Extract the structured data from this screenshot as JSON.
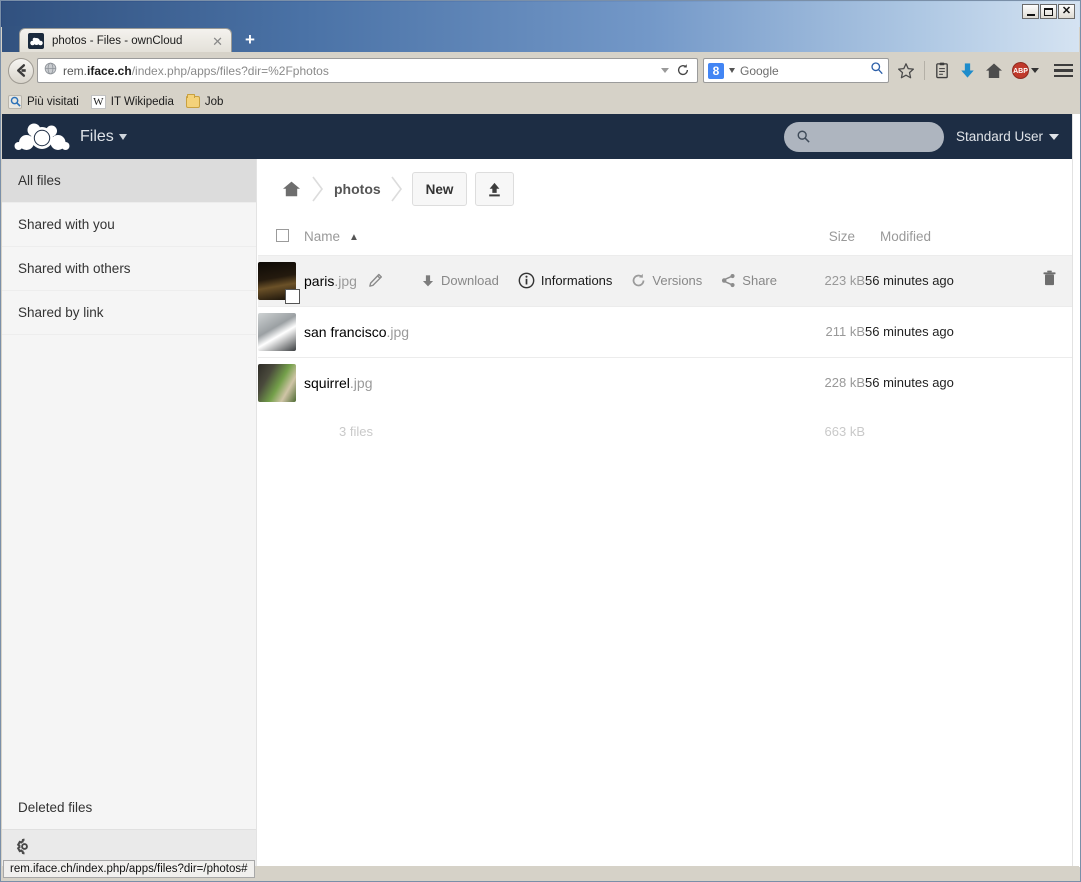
{
  "browser": {
    "window_controls": {
      "minimize": "_",
      "maximize": "□",
      "close": "✕"
    },
    "tab": {
      "title": "photos - Files - ownCloud",
      "favicon": "owncloud-icon",
      "close": "✕"
    },
    "new_tab_label": "+",
    "back_button": "back-arrow-icon",
    "url": {
      "prefix": "rem.",
      "host_bold": "iface.ch",
      "path": "/index.php/apps/files?dir=%2Fphotos"
    },
    "search": {
      "engine": "Google",
      "engine_icon": "google-g-icon"
    },
    "toolbar_icons": [
      "bookmark-star-icon",
      "reader-list-icon",
      "download-arrow-icon",
      "home-icon",
      "adblock-plus-icon",
      "menu-hamburger-icon"
    ],
    "adblock_label": "ABP",
    "bookmarks": [
      {
        "label": "Più visitati",
        "icon": "most-visited-icon"
      },
      {
        "label": "IT Wikipedia",
        "icon": "wikipedia-w-icon"
      },
      {
        "label": "Job",
        "icon": "folder-icon"
      }
    ],
    "status_tooltip": "rem.iface.ch/index.php/apps/files?dir=/photos#"
  },
  "owncloud": {
    "header": {
      "logo": "owncloud-cloud-logo",
      "app_name": "Files",
      "app_caret": "▾",
      "search_icon": "search-icon",
      "search_placeholder": "",
      "user_name": "Standard User",
      "user_caret": "▾"
    },
    "sidebar": {
      "items": [
        {
          "label": "All files",
          "active": true
        },
        {
          "label": "Shared with you",
          "active": false
        },
        {
          "label": "Shared with others",
          "active": false
        },
        {
          "label": "Shared by link",
          "active": false
        }
      ],
      "bottom_items": [
        {
          "label": "Deleted files"
        }
      ],
      "settings_icon": "gear-icon"
    },
    "controls": {
      "home_icon": "home-icon",
      "breadcrumb": "photos",
      "new_button": "New",
      "upload_button_icon": "upload-icon"
    },
    "table": {
      "headers": {
        "select_all": "select-all-checkbox",
        "name": "Name",
        "sort_indicator": "▲",
        "size": "Size",
        "modified": "Modified"
      },
      "rows": [
        {
          "name": "paris",
          "ext": ".jpg",
          "size": "223 kB",
          "modified": "56 minutes ago",
          "hovered": true,
          "thumb_colors": [
            "#1c1208",
            "#4a3a22",
            "#0b0703"
          ],
          "actions": [
            {
              "label": "Download",
              "icon": "download-icon",
              "emphasis": false
            },
            {
              "label": "Informations",
              "icon": "info-icon",
              "emphasis": true
            },
            {
              "label": "Versions",
              "icon": "versions-icon",
              "emphasis": false
            },
            {
              "label": "Share",
              "icon": "share-icon",
              "emphasis": false
            }
          ],
          "delete_icon": "trash-icon",
          "rename_icon": "pencil-icon"
        },
        {
          "name": "san francisco",
          "ext": ".jpg",
          "size": "211 kB",
          "modified": "56 minutes ago",
          "hovered": false,
          "thumb_colors": [
            "#b9bcbd",
            "#6e7275",
            "#2b2e30"
          ]
        },
        {
          "name": "squirrel",
          "ext": ".jpg",
          "size": "228 kB",
          "modified": "56 minutes ago",
          "hovered": false,
          "thumb_colors": [
            "#5f8e3a",
            "#c9bfa8",
            "#2b2b28"
          ]
        }
      ],
      "summary": {
        "files": "3 files",
        "total_size": "663 kB"
      }
    },
    "colors": {
      "header_bg": "#1d2d44",
      "sidebar_bg": "#f5f5f5",
      "active_item_bg": "#dcdcdc",
      "row_hover_bg": "#f2f2f2",
      "text_muted": "#999999"
    }
  }
}
